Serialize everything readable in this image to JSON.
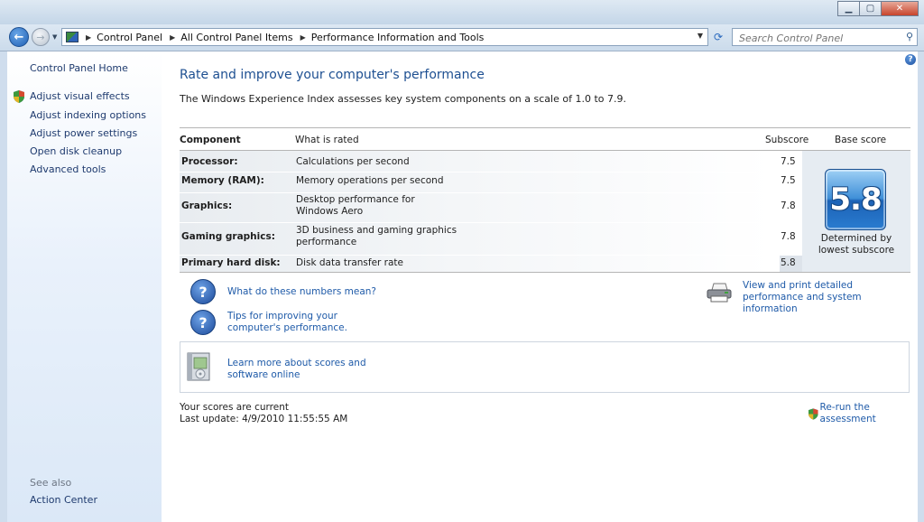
{
  "addressbar": {
    "breadcrumbs": [
      "Control Panel",
      "All Control Panel Items",
      "Performance Information and Tools"
    ],
    "search_placeholder": "Search Control Panel"
  },
  "sidebar": {
    "home": "Control Panel Home",
    "links": [
      "Adjust visual effects",
      "Adjust indexing options",
      "Adjust power settings",
      "Open disk cleanup",
      "Advanced tools"
    ],
    "see_also_heading": "See also",
    "see_also": [
      "Action Center"
    ]
  },
  "main": {
    "title": "Rate and improve your computer's performance",
    "description": "The Windows Experience Index assesses key system components on a scale of 1.0 to 7.9.",
    "table": {
      "headers": {
        "component": "Component",
        "what": "What is rated",
        "subscore": "Subscore",
        "base": "Base score"
      },
      "rows": [
        {
          "component": "Processor:",
          "what": "Calculations per second",
          "subscore": "7.5"
        },
        {
          "component": "Memory (RAM):",
          "what": "Memory operations per second",
          "subscore": "7.5"
        },
        {
          "component": "Graphics:",
          "what": "Desktop performance for Windows Aero",
          "subscore": "7.8"
        },
        {
          "component": "Gaming graphics:",
          "what": "3D business and gaming graphics performance",
          "subscore": "7.8"
        },
        {
          "component": "Primary hard disk:",
          "what": "Disk data transfer rate",
          "subscore": "5.8"
        }
      ],
      "base_score": "5.8",
      "base_note": "Determined by lowest subscore"
    },
    "links": {
      "numbers": "What do these numbers mean?",
      "tips": "Tips for improving your computer's performance.",
      "print": "View and print detailed performance and system information",
      "learn": "Learn more about scores and software online"
    },
    "status": {
      "current": "Your scores are current",
      "last_update": "Last update: 4/9/2010 11:55:55 AM",
      "rerun": "Re-run the assessment"
    }
  },
  "colors": {
    "link": "#1e5aa8",
    "title": "#1d4f91",
    "sidebar_link": "#1e3a6e"
  }
}
